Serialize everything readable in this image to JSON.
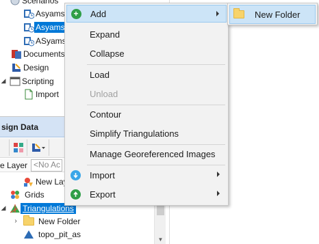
{
  "tree": {
    "items": [
      {
        "label": "Scenarios"
      },
      {
        "label": "Asyams"
      },
      {
        "label": "Asyams"
      },
      {
        "label": "ASyams"
      },
      {
        "label": "Documents"
      },
      {
        "label": "Design"
      },
      {
        "label": "Scripting"
      },
      {
        "label": "Import"
      }
    ]
  },
  "design_panel": {
    "title": "sign Data",
    "layer_label": "e Layer",
    "layer_placeholder": "<No Ac",
    "items": [
      {
        "label": "New Lay"
      },
      {
        "label": "Grids"
      },
      {
        "label": "Triangulations"
      },
      {
        "label": "New Folder"
      },
      {
        "label": "topo_pit_as"
      }
    ]
  },
  "context_menu": {
    "items": [
      {
        "label": "Add"
      },
      {
        "label": "Expand"
      },
      {
        "label": "Collapse"
      },
      {
        "label": "Load"
      },
      {
        "label": "Unload"
      },
      {
        "label": "Contour"
      },
      {
        "label": "Simplify Triangulations"
      },
      {
        "label": "Manage Georeferenced Images"
      },
      {
        "label": "Import"
      },
      {
        "label": "Export"
      }
    ]
  },
  "submenu": {
    "items": [
      {
        "label": "New Folder"
      }
    ]
  },
  "colors": {
    "selection": "#0078d7",
    "menu_hover": "#cce4f7",
    "header": "#d4e3f5",
    "add_icon": "#2e9e47",
    "import_icon": "#3aa6e8",
    "export_icon": "#2e9e47"
  }
}
